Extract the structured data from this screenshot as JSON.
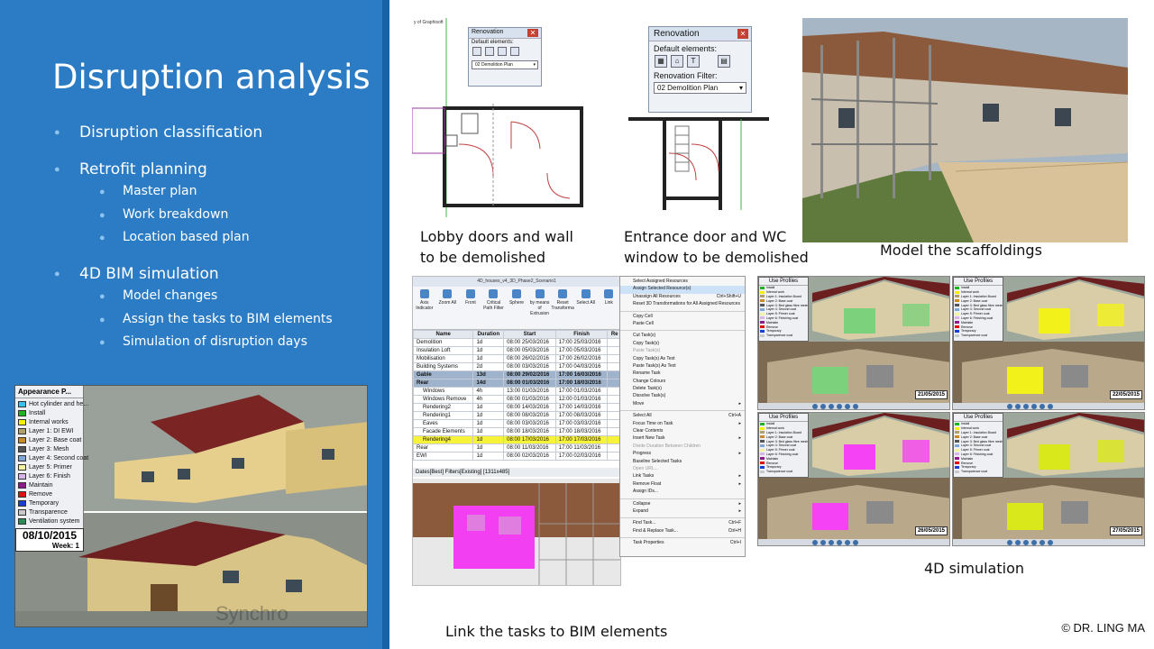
{
  "title": "Disruption analysis",
  "bullets": [
    {
      "text": "Disruption classification",
      "sub": []
    },
    {
      "text": "Retrofit planning",
      "sub": [
        "Master plan",
        "Work breakdown",
        "Location based plan"
      ]
    },
    {
      "text": "4D BIM simulation",
      "sub": [
        "Model changes",
        "Assign the tasks to BIM elements",
        "Simulation of disruption days"
      ]
    }
  ],
  "captions": {
    "lobby": [
      "Lobby doors and wall",
      "to be demolished"
    ],
    "entrance": [
      "Entrance door and WC",
      "window to be demolished"
    ],
    "scaffold": "Model the scaffoldings",
    "simulation": "4D simulation",
    "link": "Link the tasks to BIM elements"
  },
  "copyright": "© DR. LING MA",
  "renovation_small": {
    "title": "Renovation",
    "default_label": "Default elements:",
    "filter_value": "02 Demolition Plan",
    "plan_label": "y of Graphisoft"
  },
  "renovation_large": {
    "title": "Renovation",
    "default_label": "Default elements:",
    "filter_label": "Renovation Filter:",
    "filter_value": "02 Demolition Plan"
  },
  "appearance": {
    "title": "Appearance P...",
    "items": [
      {
        "label": "Hot cylinder and he...",
        "color": "#39c0ef"
      },
      {
        "label": "Install",
        "color": "#21b321"
      },
      {
        "label": "Internal works",
        "color": "#f5f000"
      },
      {
        "label": "Layer 1: DI EWI",
        "color": "#b2a06c"
      },
      {
        "label": "Layer 2: Base coat",
        "color": "#c98a28"
      },
      {
        "label": "Layer 3: Mesh",
        "color": "#555555"
      },
      {
        "label": "Layer 4: Second coat",
        "color": "#7fa6d8"
      },
      {
        "label": "Layer 5: Primer",
        "color": "#f2f2a0"
      },
      {
        "label": "Layer 6: Finish",
        "color": "#d8b5e8"
      },
      {
        "label": "Maintain",
        "color": "#8b1a8b"
      },
      {
        "label": "Remove",
        "color": "#e01010"
      },
      {
        "label": "Temporary",
        "color": "#1a3fd0"
      },
      {
        "label": "Transparence",
        "color": "#c9c9c9"
      },
      {
        "label": "Ventilation system",
        "color": "#2e8b57"
      }
    ],
    "date": "08/10/2015",
    "week": "Week: 1",
    "watermark": "Synchro"
  },
  "synchro": {
    "window_title": "4D_houses_v4_3D_Phase2_Scenario1",
    "ribbon": [
      "Axis Indicator",
      "Zoom All",
      "Front",
      "Critical Path Filter",
      "Sphere",
      "by means of Extrusion",
      "Reset Transformation(s)",
      "Select All",
      "Link"
    ],
    "ribbon_groups": [
      "Indication",
      "Zoom",
      "Viewpoint",
      "Filters",
      "Create",
      "Workspaces",
      "Edit",
      "Visib"
    ],
    "columns": [
      "Name",
      "Duration",
      "Start",
      "Finish",
      "Re"
    ],
    "rows": [
      {
        "name": "Demolition",
        "duration": "1d",
        "start": "08:00 25/03/2016",
        "finish": "17:00 25/03/2016",
        "style": "normal"
      },
      {
        "name": "Insulation Loft",
        "duration": "1d",
        "start": "08:00 05/03/2016",
        "finish": "17:00 05/03/2016",
        "style": "normal"
      },
      {
        "name": "Mobilisation",
        "duration": "1d",
        "start": "08:00 26/02/2016",
        "finish": "17:00 26/02/2016",
        "style": "normal"
      },
      {
        "name": "Building Systems",
        "duration": "2d",
        "start": "08:00 03/03/2016",
        "finish": "17:00 04/03/2016",
        "style": "normal"
      },
      {
        "name": "Gable",
        "duration": "13d",
        "start": "08:00 29/02/2016",
        "finish": "17:00 16/03/2016",
        "style": "group"
      },
      {
        "name": "Rear",
        "duration": "14d",
        "start": "08:00 01/03/2016",
        "finish": "17:00 18/03/2016",
        "style": "group"
      },
      {
        "name": "Windows",
        "duration": "4h",
        "start": "13:00 01/03/2016",
        "finish": "17:00 01/03/2016",
        "style": "normal"
      },
      {
        "name": "Windows Remove",
        "duration": "4h",
        "start": "08:00 01/03/2016",
        "finish": "12:00 01/03/2016",
        "style": "normal"
      },
      {
        "name": "Rendering2",
        "duration": "1d",
        "start": "08:00 14/03/2016",
        "finish": "17:00 14/03/2016",
        "style": "normal"
      },
      {
        "name": "Rendering1",
        "duration": "1d",
        "start": "08:00 08/03/2016",
        "finish": "17:00 08/03/2016",
        "style": "normal"
      },
      {
        "name": "Eaves",
        "duration": "1d",
        "start": "08:00 03/03/2016",
        "finish": "17:00 03/03/2016",
        "style": "normal"
      },
      {
        "name": "Facade Elements",
        "duration": "1d",
        "start": "08:00 18/03/2016",
        "finish": "17:00 18/03/2016",
        "style": "normal"
      },
      {
        "name": "Rendering4",
        "duration": "1d",
        "start": "08:00 17/03/2016",
        "finish": "17:00 17/03/2016",
        "style": "highlight"
      },
      {
        "name": "Rear",
        "duration": "1d",
        "start": "08:00 11/03/2016",
        "finish": "17:00 11/03/2016",
        "style": "normal"
      },
      {
        "name": "EWI",
        "duration": "1d",
        "start": "08:00 02/03/2016",
        "finish": "17:00 02/03/2016",
        "style": "normal"
      }
    ],
    "status_bar": "Dates[Best] Filters[Existing] [1311x485]"
  },
  "context_menu": [
    {
      "label": "Select Assigned Resources",
      "shortcut": "",
      "state": "normal"
    },
    {
      "label": "Assign Selected Resource(s)",
      "shortcut": "",
      "state": "highlight"
    },
    {
      "label": "Unassign All Resources",
      "shortcut": "Ctrl+Shift+U",
      "state": "normal"
    },
    {
      "label": "Reset 3D Transformations for All Assigned Resources",
      "shortcut": "",
      "state": "normal"
    },
    {
      "label": "",
      "shortcut": "",
      "state": "sep"
    },
    {
      "label": "Copy Cell",
      "shortcut": "",
      "state": "normal"
    },
    {
      "label": "Paste Cell",
      "shortcut": "",
      "state": "normal"
    },
    {
      "label": "",
      "shortcut": "",
      "state": "sep"
    },
    {
      "label": "Cut Task(s)",
      "shortcut": "",
      "state": "normal"
    },
    {
      "label": "Copy Task(s)",
      "shortcut": "",
      "state": "normal"
    },
    {
      "label": "Paste Task(s)",
      "shortcut": "",
      "state": "disabled"
    },
    {
      "label": "Copy Task(s) As Text",
      "shortcut": "",
      "state": "normal"
    },
    {
      "label": "Paste Task(s) As Text",
      "shortcut": "",
      "state": "normal"
    },
    {
      "label": "Rename Task",
      "shortcut": "",
      "state": "normal"
    },
    {
      "label": "Change Colours",
      "shortcut": "",
      "state": "normal"
    },
    {
      "label": "Delete Task(s)",
      "shortcut": "",
      "state": "normal"
    },
    {
      "label": "Dissolve Task(s)",
      "shortcut": "",
      "state": "normal"
    },
    {
      "label": "Move",
      "shortcut": "▸",
      "state": "normal"
    },
    {
      "label": "",
      "shortcut": "",
      "state": "sep"
    },
    {
      "label": "Select All",
      "shortcut": "Ctrl+A",
      "state": "normal"
    },
    {
      "label": "Focus Time on Task",
      "shortcut": "▸",
      "state": "normal"
    },
    {
      "label": "Clear Contents",
      "shortcut": "",
      "state": "normal"
    },
    {
      "label": "Insert New Task",
      "shortcut": "▸",
      "state": "normal"
    },
    {
      "label": "Divide Duration Between Children",
      "shortcut": "",
      "state": "disabled"
    },
    {
      "label": "Progress",
      "shortcut": "▸",
      "state": "normal"
    },
    {
      "label": "Baseline Selected Tasks",
      "shortcut": "",
      "state": "normal"
    },
    {
      "label": "Open URL...",
      "shortcut": "",
      "state": "disabled"
    },
    {
      "label": "Link Tasks",
      "shortcut": "▸",
      "state": "normal"
    },
    {
      "label": "Remove Float",
      "shortcut": "▸",
      "state": "normal"
    },
    {
      "label": "Assign IDs...",
      "shortcut": "",
      "state": "normal"
    },
    {
      "label": "",
      "shortcut": "",
      "state": "sep"
    },
    {
      "label": "Collapse",
      "shortcut": "▸",
      "state": "normal"
    },
    {
      "label": "Expand",
      "shortcut": "▸",
      "state": "normal"
    },
    {
      "label": "",
      "shortcut": "",
      "state": "sep"
    },
    {
      "label": "Find Task...",
      "shortcut": "Ctrl+F",
      "state": "normal"
    },
    {
      "label": "Find & Replace Task...",
      "shortcut": "Ctrl+H",
      "state": "normal"
    },
    {
      "label": "",
      "shortcut": "",
      "state": "sep"
    },
    {
      "label": "Task Properties",
      "shortcut": "Ctrl+I",
      "state": "normal"
    }
  ],
  "sim_frames": [
    {
      "date": "21/05/2015",
      "highlight": "#7cd17c"
    },
    {
      "date": "22/05/2015",
      "highlight": "#f2f21a"
    },
    {
      "date": "26/05/2015",
      "highlight": "#f542f5"
    },
    {
      "date": "27/05/2015",
      "highlight": "#d8e81a"
    }
  ],
  "use_profiles": {
    "title": "Use Profiles",
    "items": [
      {
        "label": "Install",
        "color": "#21b321"
      },
      {
        "label": "Internal work",
        "color": "#f5f000"
      },
      {
        "label": "Layer 1: Insulation Board",
        "color": "#b2a06c"
      },
      {
        "label": "Layer 2: Base coat",
        "color": "#c98a28"
      },
      {
        "label": "Layer 3: Bed glass fibre mesh",
        "color": "#555555"
      },
      {
        "label": "Layer 4: Second coat",
        "color": "#7fa6d8"
      },
      {
        "label": "Layer 5: Primer coat",
        "color": "#f2f2a0"
      },
      {
        "label": "Layer 6: Finishing coat",
        "color": "#d8b5e8"
      },
      {
        "label": "Maintain",
        "color": "#8b1a8b"
      },
      {
        "label": "Remove",
        "color": "#e01010"
      },
      {
        "label": "Temporary",
        "color": "#1a3fd0"
      },
      {
        "label": "Transparence coat",
        "color": "#c9c9c9"
      }
    ]
  }
}
